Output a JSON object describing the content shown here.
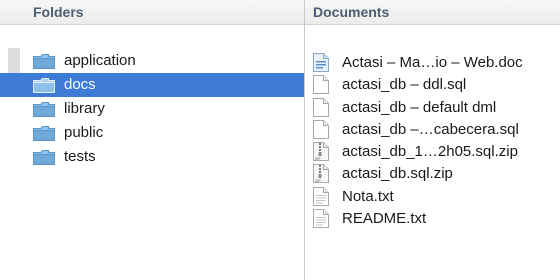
{
  "folders": {
    "header": "Folders",
    "items": [
      {
        "label": "application",
        "icon": "folder-icon",
        "selected": false
      },
      {
        "label": "docs",
        "icon": "folder-icon",
        "selected": true
      },
      {
        "label": "library",
        "icon": "folder-icon",
        "selected": false
      },
      {
        "label": "public",
        "icon": "folder-icon",
        "selected": false
      },
      {
        "label": "tests",
        "icon": "folder-icon",
        "selected": false
      }
    ]
  },
  "documents": {
    "header": "Documents",
    "items": [
      {
        "label": "Actasi – Ma…io – Web.doc",
        "icon": "word-document-icon"
      },
      {
        "label": "actasi_db – ddl.sql",
        "icon": "document-icon"
      },
      {
        "label": "actasi_db – default dml",
        "icon": "document-icon"
      },
      {
        "label": "actasi_db –…cabecera.sql",
        "icon": "document-icon"
      },
      {
        "label": "actasi_db_1…2h05.sql.zip",
        "icon": "zip-archive-icon"
      },
      {
        "label": "actasi_db.sql.zip",
        "icon": "zip-archive-icon"
      },
      {
        "label": "Nota.txt",
        "icon": "text-file-icon"
      },
      {
        "label": "README.txt",
        "icon": "text-file-icon"
      }
    ]
  },
  "colors": {
    "selection": "#3d7bd6",
    "header_text": "#4d5d73",
    "folder_icon": "#6fa8d9"
  }
}
